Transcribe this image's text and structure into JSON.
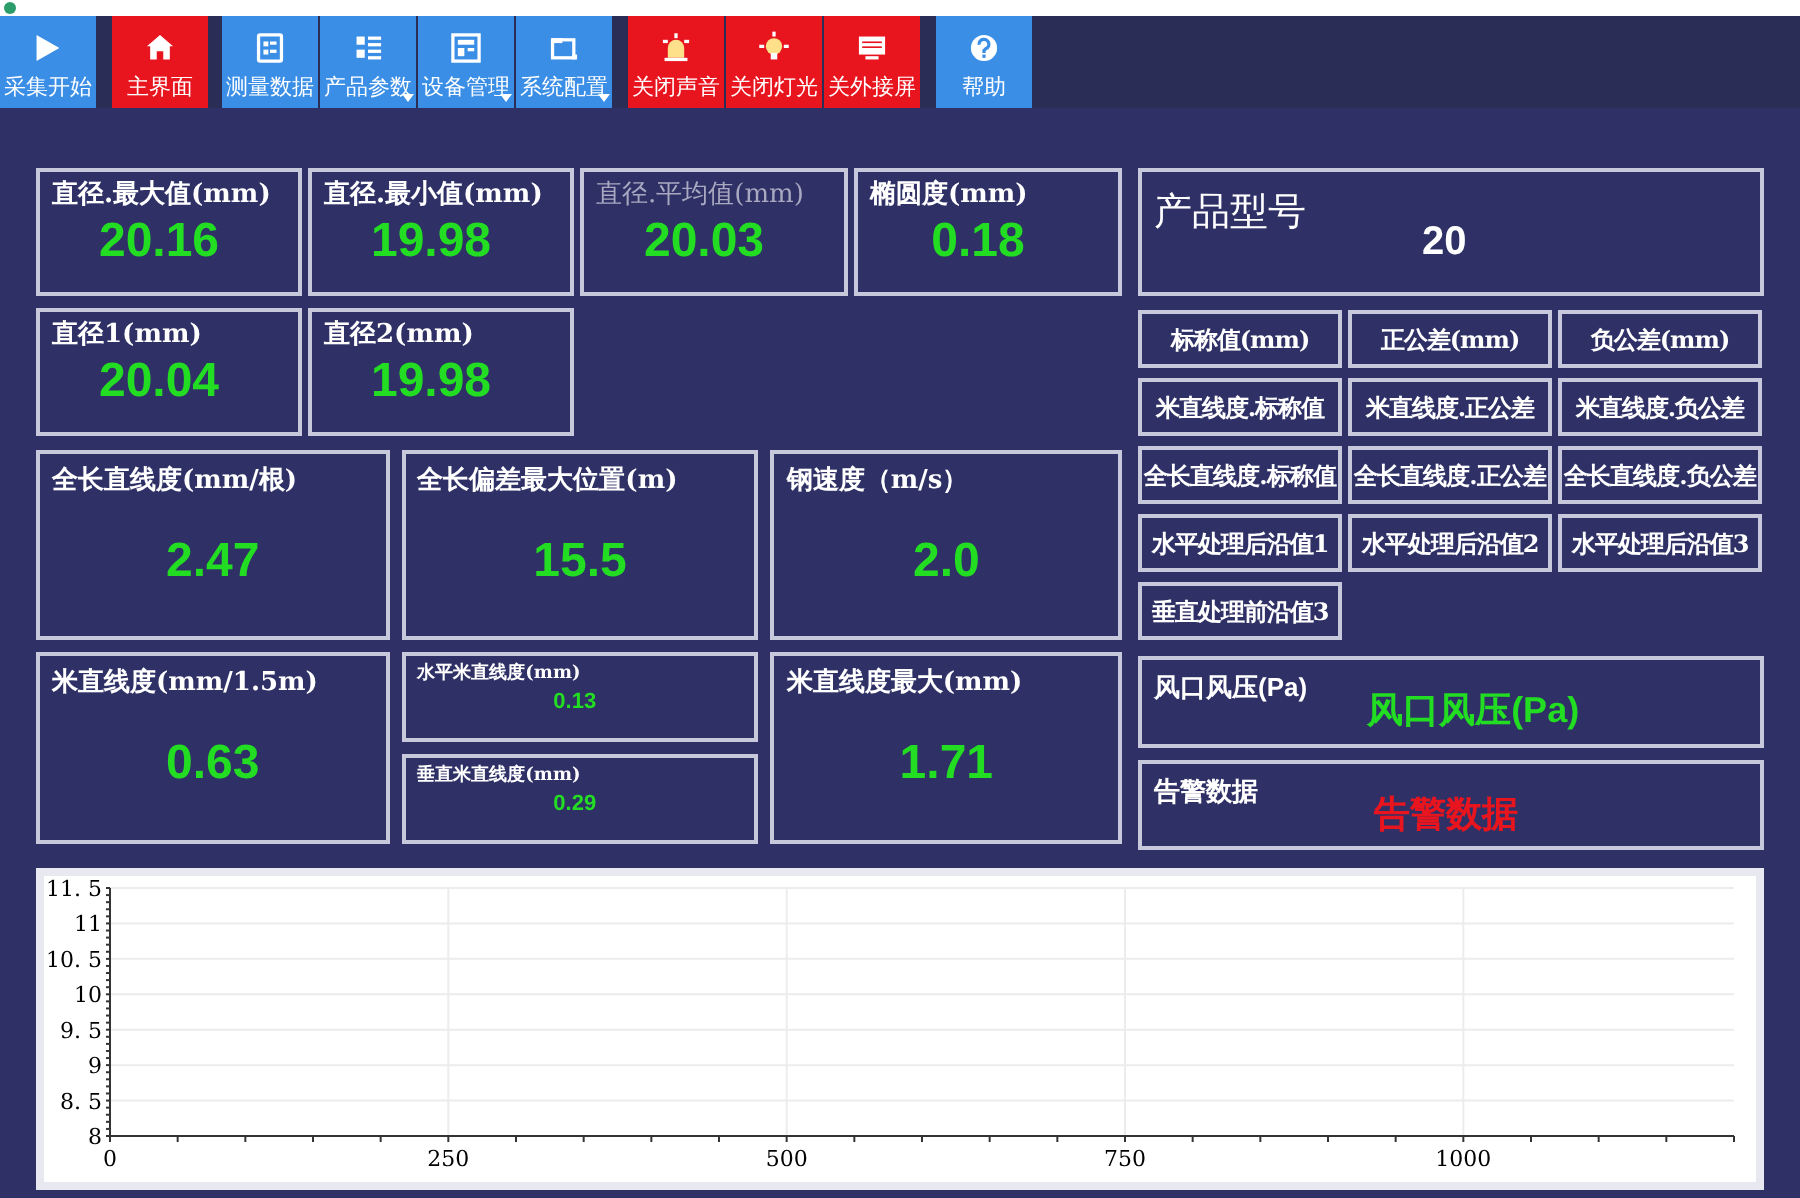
{
  "toolbar": {
    "buttons": [
      {
        "label": "采集开始",
        "color": "#3a8ee6",
        "kind": "play",
        "dropdown": false
      },
      {
        "label": "主界面",
        "color": "#e8141e",
        "kind": "home",
        "dropdown": false
      },
      {
        "label": "测量数据",
        "color": "#3a8ee6",
        "kind": "list",
        "dropdown": false
      },
      {
        "label": "产品参数",
        "color": "#3a8ee6",
        "kind": "grid",
        "dropdown": true
      },
      {
        "label": "设备管理",
        "color": "#3a8ee6",
        "kind": "panel",
        "dropdown": true
      },
      {
        "label": "系统配置",
        "color": "#3a8ee6",
        "kind": "window",
        "dropdown": true
      },
      {
        "label": "关闭声音",
        "color": "#e8141e",
        "kind": "siren",
        "dropdown": false
      },
      {
        "label": "关闭灯光",
        "color": "#e8141e",
        "kind": "bulb",
        "dropdown": false
      },
      {
        "label": "关外接屏",
        "color": "#e8141e",
        "kind": "screen",
        "dropdown": false
      },
      {
        "label": "帮助",
        "color": "#3a8ee6",
        "kind": "help",
        "dropdown": false
      }
    ]
  },
  "row_1": [
    {
      "label": "直径.最大值(mm)",
      "value": "20.16",
      "dimmed": false
    },
    {
      "label": "直径.最小值(mm)",
      "value": "19.98",
      "dimmed": false
    },
    {
      "label": "直径.平均值(mm)",
      "value": "20.03",
      "dimmed": true
    },
    {
      "label": "椭圆度(mm)",
      "value": "0.18",
      "dimmed": false
    }
  ],
  "row_2": [
    {
      "label": "直径1(mm)",
      "value": "20.04",
      "dimmed": false
    },
    {
      "label": "直径2(mm)",
      "value": "19.98",
      "dimmed": false
    }
  ],
  "row_3": [
    {
      "label": "全长直线度(mm/根)",
      "value": "2.47"
    },
    {
      "label": "全长偏差最大位置(m)",
      "value": "15.5"
    },
    {
      "label": "钢速度（m/s）",
      "value": "2.0"
    }
  ],
  "row_4": {
    "left": {
      "label": "米直线度(mm/1.5m)",
      "value": "0.63"
    },
    "middle": [
      {
        "label": "水平米直线度(mm)",
        "value": "0.13"
      },
      {
        "label": "垂直米直线度(mm)",
        "value": "0.29"
      }
    ],
    "right": {
      "label": "米直线度最大(mm)",
      "value": "1.71"
    }
  },
  "product": {
    "label": "产品型号",
    "value": "20"
  },
  "spec_table": [
    [
      "标称值(mm)",
      "正公差(mm)",
      "负公差(mm)"
    ],
    [
      "米直线度.标称值",
      "米直线度.正公差",
      "米直线度.负公差"
    ],
    [
      "全长直线度.标称值",
      "全长直线度.正公差",
      "全长直线度.负公差"
    ],
    [
      "水平处理后沿值1",
      "水平处理后沿值2",
      "水平处理后沿值3"
    ],
    [
      "垂直处理前沿值3"
    ]
  ],
  "wind_pressure": {
    "label": "风口风压(Pa)",
    "value": "风口风压(Pa)"
  },
  "alarm": {
    "label": "告警数据",
    "value": "告警数据"
  },
  "chart": {
    "chart_data": {
      "type": "line",
      "grid": true,
      "xlim": [
        0,
        1200
      ],
      "ylim": [
        8,
        11.5
      ],
      "xticks": [
        0,
        250,
        500,
        750,
        1000
      ],
      "yticks": [
        {
          "value": 8,
          "label": "8"
        },
        {
          "value": 8.5,
          "label": "8. 5"
        },
        {
          "value": 9,
          "label": "9"
        },
        {
          "value": 9.5,
          "label": "9. 5"
        },
        {
          "value": 10,
          "label": "10"
        },
        {
          "value": 10.5,
          "label": "10. 5"
        },
        {
          "value": 11,
          "label": "11"
        },
        {
          "value": 11.5,
          "label": "11. 5"
        }
      ]
    }
  }
}
